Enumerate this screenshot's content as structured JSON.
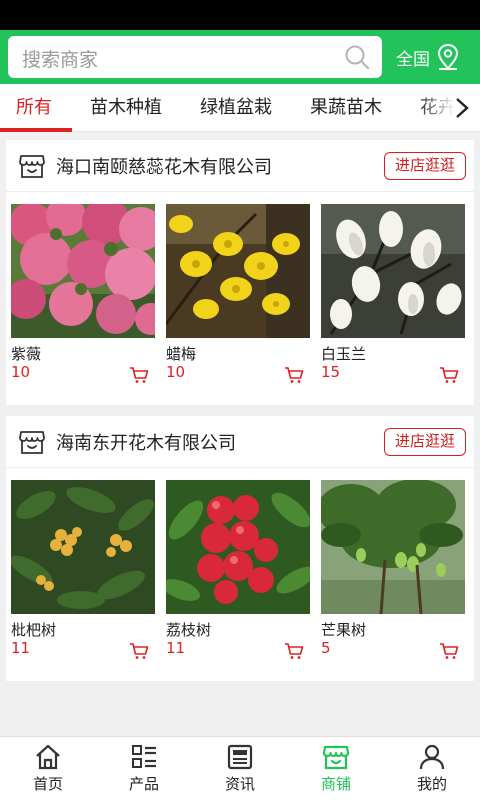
{
  "search": {
    "placeholder": "搜索商家",
    "region_label": "全国"
  },
  "tabs": [
    {
      "label": "所有",
      "active": true
    },
    {
      "label": "苗木种植"
    },
    {
      "label": "绿植盆栽"
    },
    {
      "label": "果蔬苗木"
    },
    {
      "label": "花卉"
    }
  ],
  "shops": [
    {
      "name": "海口南颐慈蕊花木有限公司",
      "visit_label": "进店逛逛",
      "products": [
        {
          "name": "紫薇",
          "price": "10"
        },
        {
          "name": "蜡梅",
          "price": "10"
        },
        {
          "name": "白玉兰",
          "price": "15"
        }
      ]
    },
    {
      "name": "海南东开花木有限公司",
      "visit_label": "进店逛逛",
      "products": [
        {
          "name": "枇杷树",
          "price": "11"
        },
        {
          "name": "荔枝树",
          "price": "11"
        },
        {
          "name": "芒果树",
          "price": "5"
        }
      ]
    }
  ],
  "bottom_nav": [
    {
      "label": "首页",
      "icon": "home-icon"
    },
    {
      "label": "产品",
      "icon": "products-grid-icon"
    },
    {
      "label": "资讯",
      "icon": "news-icon"
    },
    {
      "label": "商铺",
      "icon": "store-icon",
      "active": true
    },
    {
      "label": "我的",
      "icon": "user-icon"
    }
  ],
  "colors": {
    "brand_green": "#21c35a",
    "accent_red": "#e02020"
  }
}
